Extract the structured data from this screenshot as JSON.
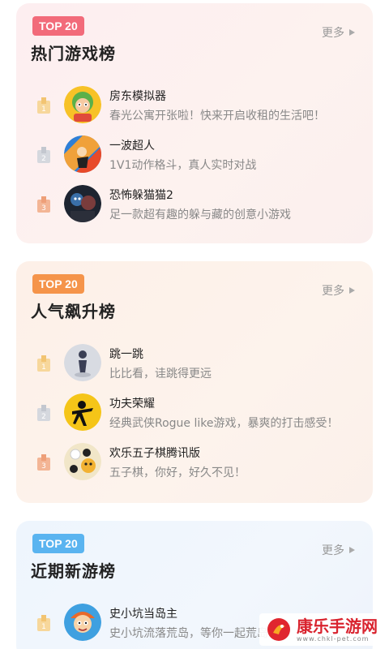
{
  "sections": [
    {
      "badge": "TOP 20",
      "badge_color": "#f26b7a",
      "title": "热门游戏榜",
      "more": "更多",
      "games": [
        {
          "rank": "1",
          "name": "房东模拟器",
          "desc": "春光公寓开张啦！快来开启收租的生活吧！",
          "icon": "landlord-sim-icon"
        },
        {
          "rank": "2",
          "name": "一波超人",
          "desc": "1V1动作格斗，真人实时对战",
          "icon": "wave-superman-icon"
        },
        {
          "rank": "3",
          "name": "恐怖躲猫猫2",
          "desc": "足一款超有趣的躲与藏的创意小游戏",
          "icon": "horror-hide-seek-icon"
        }
      ]
    },
    {
      "badge": "TOP 20",
      "badge_color": "#f5944a",
      "title": "人气飙升榜",
      "more": "更多",
      "games": [
        {
          "rank": "1",
          "name": "跳一跳",
          "desc": "比比看，诖跳得更远",
          "icon": "jump-jump-icon"
        },
        {
          "rank": "2",
          "name": "功夫荣耀",
          "desc": "经典武侠Rogue like游戏，暴爽的打击感受！",
          "icon": "kungfu-glory-icon"
        },
        {
          "rank": "3",
          "name": "欢乐五子棋腾讯版",
          "desc": "五子棋，你好，好久不见！",
          "icon": "gomoku-icon"
        }
      ]
    },
    {
      "badge": "TOP 20",
      "badge_color": "#5ab4f0",
      "title": "近期新游榜",
      "more": "更多",
      "games": [
        {
          "rank": "1",
          "name": "史小坑当岛主",
          "desc": "史小坑流落荒岛，等你一起荒岛",
          "icon": "island-owner-icon"
        }
      ]
    }
  ],
  "watermark": {
    "main": "康乐手游网",
    "sub": "www.chkl-pet.com",
    "logo_color": "#e0262f"
  }
}
